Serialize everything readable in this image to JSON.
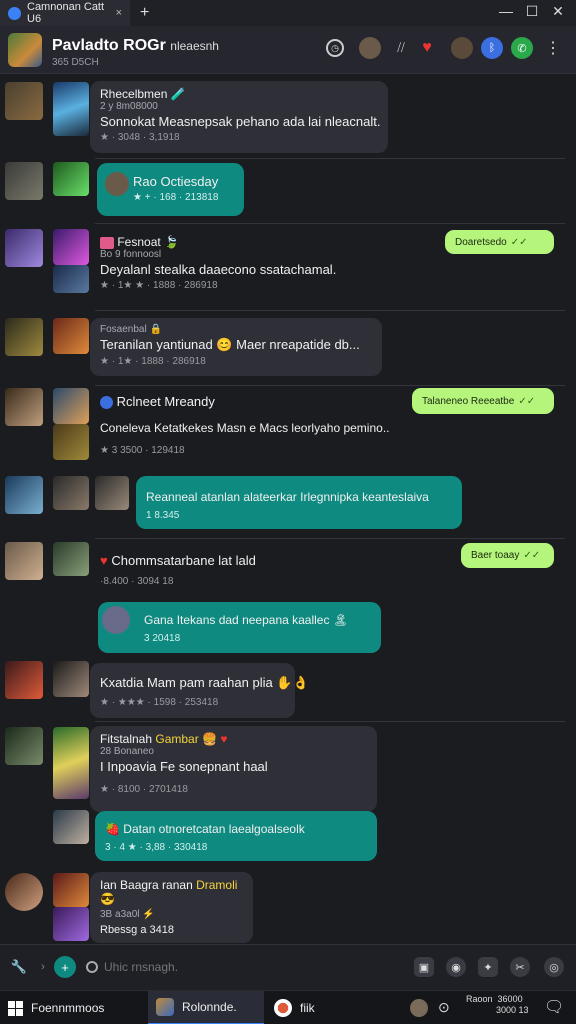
{
  "tab": {
    "title": "Camnonan Catt U6",
    "close": "×",
    "new": "+"
  },
  "window": {
    "minimize": "—",
    "maximize": "☐",
    "close": "✕"
  },
  "header": {
    "title": "Pavladto ROGr",
    "title_suffix": "nleaesnh",
    "subtitle": "365 D5CH",
    "icons": [
      "clock-icon",
      "avatar-icon",
      "mute-icon",
      "heart-icon",
      "avatar-icon",
      "bluetooth-icon",
      "phone-icon",
      "more-icon"
    ]
  },
  "messages": [
    {
      "name": "Rhecelbmen",
      "emoji": "🧪",
      "sub": "2 y 8m08000",
      "text": "Sonnokat Measnepsak pehano ada lai nleacnalt.",
      "meta": "★ · 3048 · 3,1918"
    },
    {
      "text": "Rao Octiesday",
      "meta": "★ + · 168 · 213818"
    },
    {
      "name": "Fesnoat",
      "emoji": "🍃",
      "sub": "Bo 9 fonnoosl",
      "text": "Deyalanl stealka daaecono ssatachamal.",
      "meta": "★ · 1★ ★ · 1888 · 286918",
      "right": "Doaretsedo"
    },
    {
      "name": "Fosaenbal",
      "sub": "",
      "text": "Teranilan yantiunad",
      "text2": "Maer nreapatide db...",
      "meta": "★ · 1★ · 1888 · 286918"
    },
    {
      "name": "Rclneet Mreandy",
      "text": "Coneleva Ketatkekes Masn e Macs leorlyaho pemino..",
      "meta": "★ 3 3500 · 129418",
      "right": "Talaneneo Reeeatbe"
    },
    {
      "text": "Reanneal atanlan alateerkar Irlegnnipka keanteslaiva",
      "meta": "1 8.345"
    },
    {
      "name": "Chommsatarbane lat lald",
      "meta": "·8.400 · 3094 18",
      "right": "Baer toaay"
    },
    {
      "text": "Gana Itekans dad neepana kaallec 🏝",
      "meta": "3 20418"
    },
    {
      "text": "Kxatdia Mam pam raahan plia",
      "meta": "★ · ★★★ · 1598 · 253418"
    },
    {
      "name": "Fitstalnah",
      "name_accent": "Gambar",
      "sub": "28 Bonaneo",
      "text": "I Inpoavia Fe sonepnant haal",
      "meta": "★ · 8100 · 2701418"
    },
    {
      "text": "Datan otnoretcatan laealgoalseolk",
      "meta": "3 · 4 ★ · 3,88 · 330418"
    },
    {
      "name": "Ian Baagra ranan",
      "name_accent": "Dramoli",
      "sub": "3B a3a0l",
      "text": "Rbessg a 3418"
    }
  ],
  "composer": {
    "placeholder": "Uhic rnsnagh."
  },
  "taskbar": {
    "start_label": "Foennmmoos",
    "app1": "Rolonnde.",
    "app2": "fiik",
    "clock_time": "Raoon",
    "clock_date1": "36000",
    "clock_date2": "3000 13"
  },
  "colors": {
    "teal": "#0f8a80",
    "green": "#b6f57b",
    "accent": "#3b82f6"
  }
}
